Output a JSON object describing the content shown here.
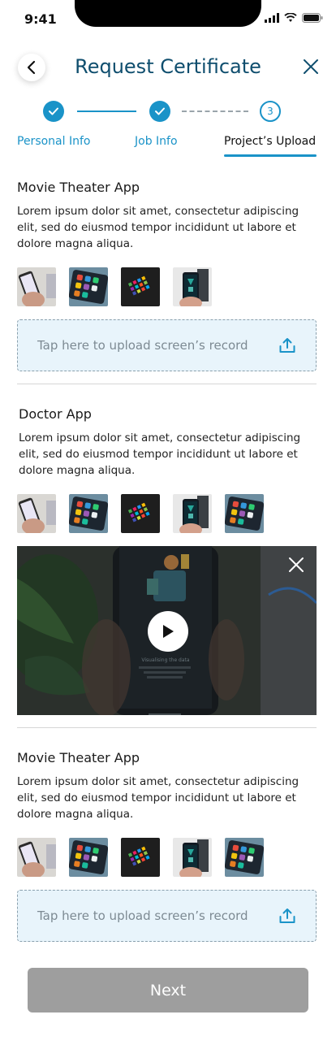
{
  "status": {
    "time": "9:41"
  },
  "header": {
    "title": "Request Certificate"
  },
  "stepper": {
    "current_step": "3"
  },
  "tabs": [
    {
      "label": "Personal Info"
    },
    {
      "label": "Job Info"
    },
    {
      "label": "Project’s Upload"
    }
  ],
  "sections": [
    {
      "title": "Movie Theater App",
      "description": "Lorem ipsum dolor sit amet, consectetur adipiscing elit, sed do eiusmod tempor incididunt ut labore et dolore magna aliqua.",
      "upload_label": "Tap here to upload screen’s record"
    },
    {
      "title": "Doctor App",
      "description": "Lorem ipsum dolor sit amet, consectetur adipiscing elit, sed do eiusmod tempor incididunt ut labore et dolore magna aliqua.",
      "video_caption": "Visualising the data"
    },
    {
      "title": "Movie Theater App",
      "description": "Lorem ipsum dolor sit amet, consectetur adipiscing elit, sed do eiusmod tempor incididunt ut labore et dolore magna aliqua.",
      "upload_label": "Tap here to upload screen’s record"
    }
  ],
  "footer": {
    "next_label": "Next"
  },
  "colors": {
    "primary": "#1a93c8",
    "title": "#0f4e6e",
    "upload_bg": "#e8f4fb",
    "button_disabled": "#9e9e9e"
  }
}
